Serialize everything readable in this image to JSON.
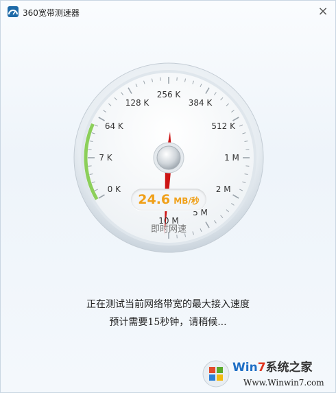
{
  "window": {
    "title": "360宽带测速器",
    "close_symbol": "×"
  },
  "gauge": {
    "scale_labels": [
      "0 K",
      "7 K",
      "64 K",
      "128 K",
      "256 K",
      "384 K",
      "512 K",
      "1 M",
      "2 M",
      "5 M",
      "10 M"
    ],
    "speed_value": "24.6",
    "speed_unit": "MB/秒",
    "caption": "即时网速",
    "needle_scale_position": 10.1,
    "colors": {
      "needle": "#cc1414",
      "progress": "#8ccf5a",
      "speed_text": "#f0a019"
    }
  },
  "status": {
    "line1": "正在测试当前网络带宽的最大接入速度",
    "line2": "预计需要15秒钟，请稍候..."
  },
  "watermark": {
    "title_prefix": "W",
    "title_in": "in",
    "title_num": "7",
    "title_suffix": "系统之家",
    "url": "Www.Winwin7.com"
  }
}
